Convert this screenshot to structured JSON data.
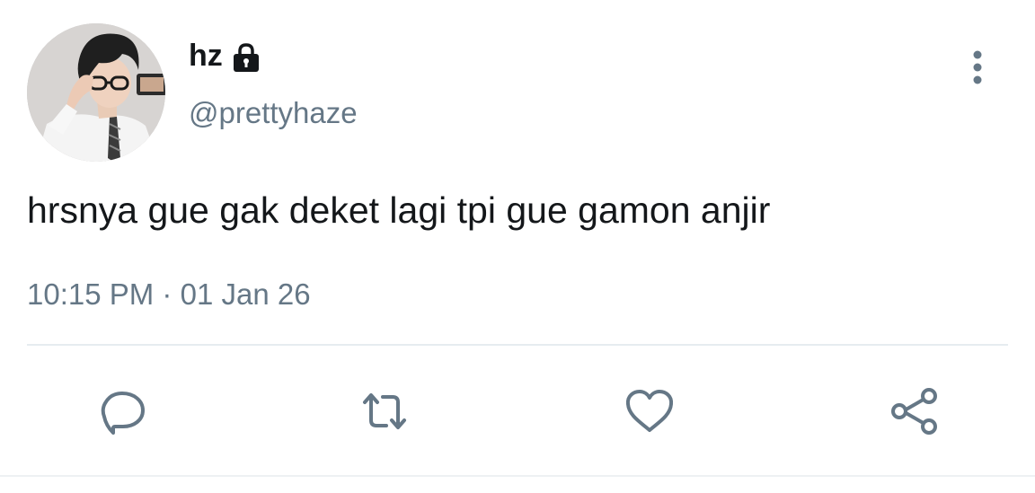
{
  "user": {
    "display_name": "hz",
    "handle": "@prettyhaze",
    "protected_icon": "lock-icon",
    "avatar_alt": "profile photo"
  },
  "tweet": {
    "text": "hrsnya gue gak deket lagi tpi gue gamon anjir",
    "time": "10:15 PM",
    "separator": "·",
    "date": "01 Jan 26"
  },
  "actions": {
    "reply_icon": "reply-icon",
    "retweet_icon": "retweet-icon",
    "like_icon": "heart-icon",
    "share_icon": "share-icon",
    "more_icon": "more-vertical-icon"
  },
  "colors": {
    "text_primary": "#14171a",
    "text_secondary": "#657786",
    "divider": "#e6ecf0"
  }
}
